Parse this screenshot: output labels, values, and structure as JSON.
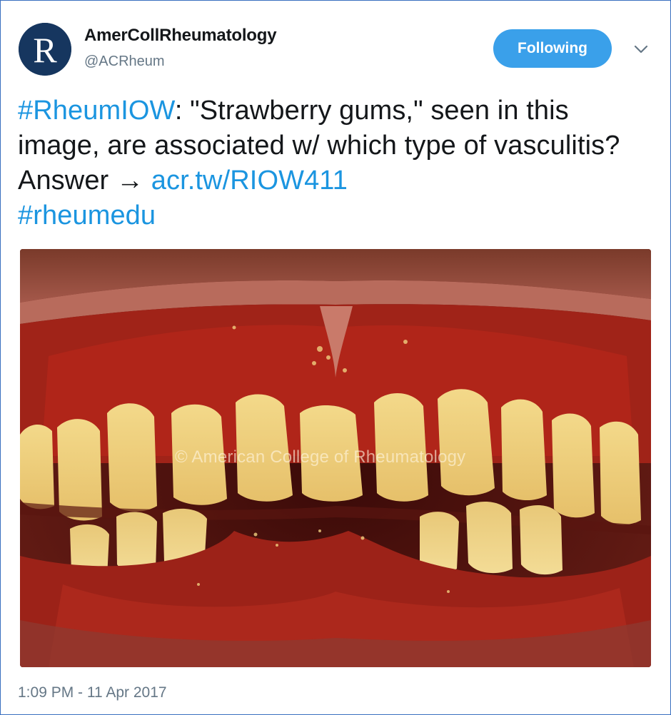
{
  "account": {
    "display_name": "AmerCollRheumatology",
    "handle": "@ACRheum",
    "avatar_letter": "R",
    "avatar_color": "#16365f"
  },
  "actions": {
    "follow_label": "Following",
    "follow_color": "#3aa0ea",
    "menu_icon": "chevron-down-icon"
  },
  "tweet": {
    "hashtag_1": "#RheumIOW",
    "text_main": ": \"Strawberry gums,\" seen in this image, are associated w/ which type of vasculitis? Answer → ",
    "link": "acr.tw/RIOW411",
    "hashtag_2": "#rheumedu",
    "link_color": "#1b95e0"
  },
  "media": {
    "watermark": "© American College of Rheumatology"
  },
  "timestamp": "1:09 PM - 11 Apr 2017"
}
